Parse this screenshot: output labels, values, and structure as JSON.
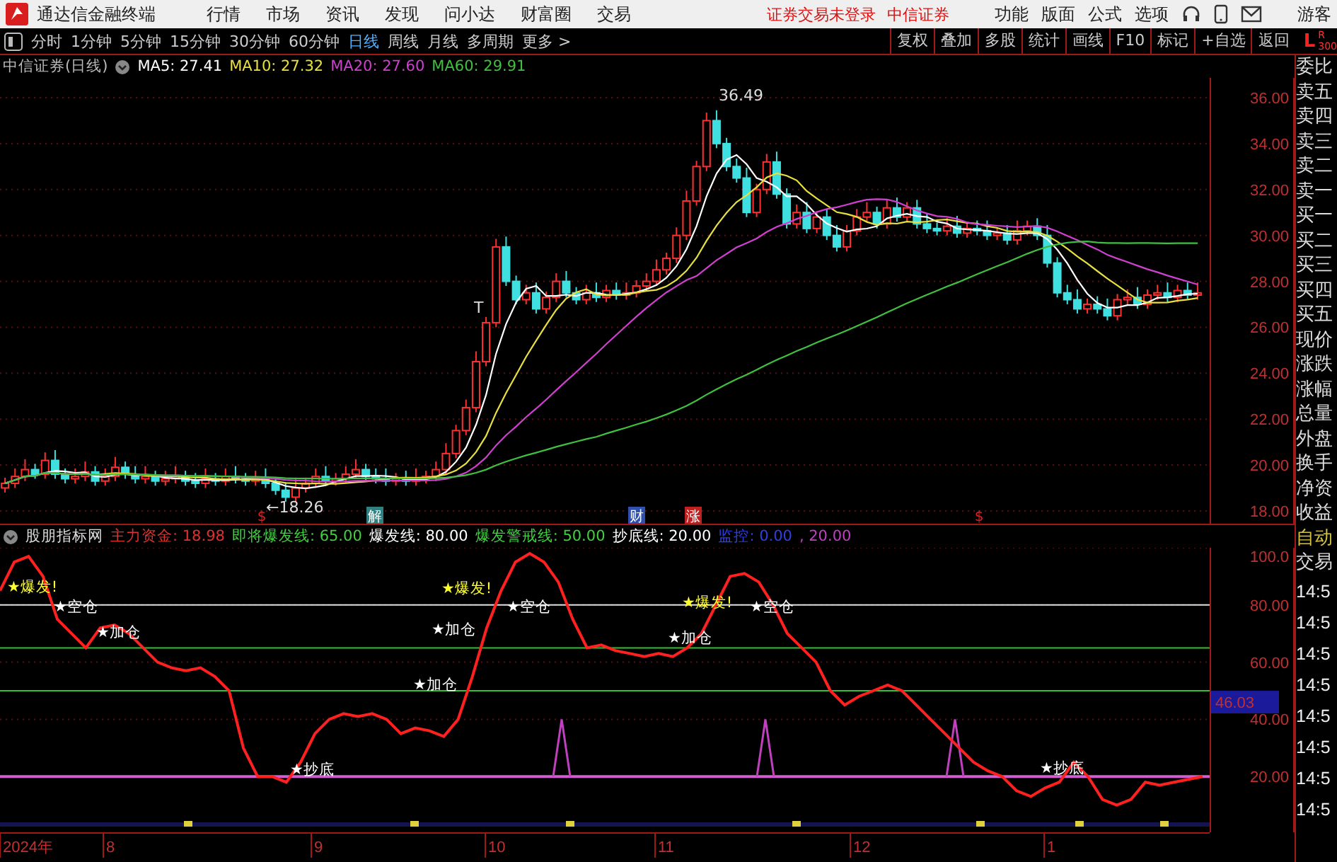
{
  "menu_bar": {
    "app_title": "通达信金融终端",
    "items": [
      "行情",
      "市场",
      "资讯",
      "发现",
      "问小达",
      "财富圈",
      "交易"
    ],
    "notices": [
      "证券交易未登录",
      "中信证券"
    ],
    "right_items": [
      "功能",
      "版面",
      "公式",
      "选项"
    ],
    "user": "游客"
  },
  "toolbar": {
    "periods": [
      {
        "label": "分时",
        "selected": false
      },
      {
        "label": "1分钟",
        "selected": false
      },
      {
        "label": "5分钟",
        "selected": false
      },
      {
        "label": "15分钟",
        "selected": false
      },
      {
        "label": "30分钟",
        "selected": false
      },
      {
        "label": "60分钟",
        "selected": false
      },
      {
        "label": "日线",
        "selected": true
      },
      {
        "label": "周线",
        "selected": false
      },
      {
        "label": "月线",
        "selected": false
      },
      {
        "label": "多周期",
        "selected": false
      }
    ],
    "more": "更多 >",
    "actions": [
      "复权",
      "叠加",
      "多股",
      "统计",
      "画线",
      "F10",
      "标记",
      "+自选",
      "返回"
    ],
    "corner_left": "L",
    "corner_right": "R",
    "corner_number": "300"
  },
  "main_chart": {
    "title": "中信证券(日线)",
    "ma": [
      {
        "label": "MA5: 27.41",
        "color": "#ffffff"
      },
      {
        "label": "MA10: 27.32",
        "color": "#e8e040"
      },
      {
        "label": "MA20: 27.60",
        "color": "#d040d0"
      },
      {
        "label": "MA60: 29.91",
        "color": "#40c040"
      }
    ],
    "y_labels": [
      "36.00",
      "34.00",
      "32.00",
      "30.00",
      "28.00",
      "26.00",
      "24.00",
      "22.00",
      "20.00",
      "18.00"
    ],
    "peak_label": "36.49",
    "low_label": "←18.26",
    "t_marker": "T",
    "event_markers": [
      {
        "label": "$",
        "kind": "plain",
        "color": "#e02020"
      },
      {
        "label": "解",
        "kind": "boxed",
        "color": "#308080"
      },
      {
        "label": "财",
        "kind": "boxed",
        "color": "#3050b0"
      },
      {
        "label": "涨",
        "kind": "boxed",
        "color": "#c02020"
      },
      {
        "label": "$",
        "kind": "plain",
        "color": "#e02020"
      }
    ]
  },
  "indicator": {
    "name": "股朋指标网",
    "legend": [
      {
        "label": "主力资金: 18.98",
        "color": "#e03030"
      },
      {
        "label": "即将爆发线: 65.00",
        "color": "#40d040"
      },
      {
        "label": "爆发线: 80.00",
        "color": "#ffffff"
      },
      {
        "label": "爆发警戒线: 50.00",
        "color": "#40d040"
      },
      {
        "label": "抄底线: 20.00",
        "color": "#ffffff"
      },
      {
        "label": "监控: 0.00",
        "color": "#3040e0"
      },
      {
        "label": ", 20.00",
        "color": "#c040c0"
      }
    ],
    "y_labels": [
      "100.0",
      "80.00",
      "60.00",
      "40.00",
      "20.00"
    ],
    "current_value": "46.03",
    "signals": [
      {
        "label": "★爆发!",
        "kind": "burst"
      },
      {
        "label": "★空仓",
        "kind": "empty"
      },
      {
        "label": "★加仓",
        "kind": "add"
      },
      {
        "label": "★抄底",
        "kind": "bottom"
      },
      {
        "label": "★加仓",
        "kind": "add"
      },
      {
        "label": "★加仓",
        "kind": "add"
      },
      {
        "label": "★爆发!",
        "kind": "burst"
      },
      {
        "label": "★空仓",
        "kind": "empty"
      },
      {
        "label": "★加仓",
        "kind": "add"
      },
      {
        "label": "★爆发!",
        "kind": "burst"
      },
      {
        "label": "★空仓",
        "kind": "empty"
      },
      {
        "label": "★抄底",
        "kind": "bottom"
      }
    ]
  },
  "date_axis": [
    "2024年",
    "8",
    "9",
    "10",
    "11",
    "12",
    "1"
  ],
  "quote_panel": {
    "labels": [
      "委比",
      "卖五",
      "卖四",
      "卖三",
      "卖二",
      "卖一",
      "买一",
      "买二",
      "买三",
      "买四",
      "买五",
      "现价",
      "涨跌",
      "涨幅",
      "总量",
      "外盘",
      "换手",
      "净资",
      "收益"
    ],
    "mode": [
      "自动",
      "交易"
    ],
    "times": [
      "14:5",
      "14:5",
      "14:5",
      "14:5",
      "14:5",
      "14:5",
      "14:5",
      "14:5"
    ]
  }
}
